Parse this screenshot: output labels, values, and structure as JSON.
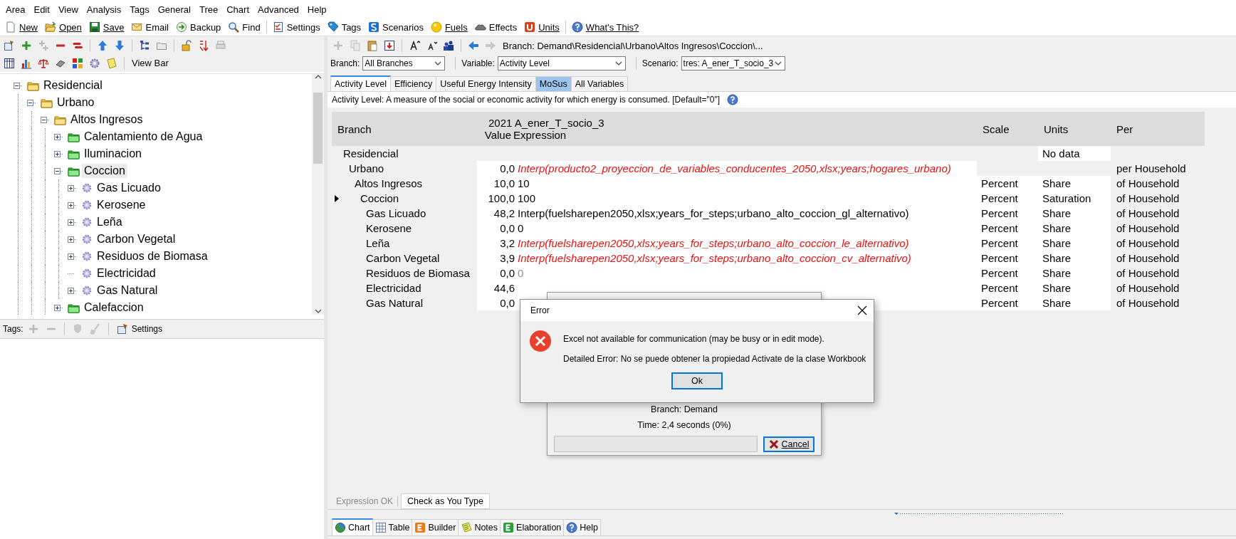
{
  "menu": [
    "Area",
    "Edit",
    "View",
    "Analysis",
    "Tags",
    "General",
    "Tree",
    "Chart",
    "Advanced",
    "Help"
  ],
  "main_toolbar": [
    {
      "label": "New",
      "kind": "new"
    },
    {
      "label": "Open",
      "kind": "open"
    },
    {
      "label": "Save",
      "kind": "save"
    },
    {
      "label": "Email",
      "kind": "email"
    },
    {
      "label": "Backup",
      "kind": "backup"
    },
    {
      "label": "Find",
      "kind": "find"
    },
    {
      "label": "Settings",
      "kind": "settings"
    },
    {
      "label": "Tags",
      "kind": "tags"
    },
    {
      "label": "Scenarios",
      "kind": "scenarios"
    },
    {
      "label": "Fuels",
      "kind": "fuels"
    },
    {
      "label": "Effects",
      "kind": "effects"
    },
    {
      "label": "Units",
      "kind": "units"
    },
    {
      "label": "What's This?",
      "kind": "help"
    }
  ],
  "view_bar_button": "View Bar",
  "tree": [
    {
      "label": "Residencial",
      "kind": "sector",
      "expandable": true,
      "expanded": true,
      "selected": false,
      "children": [
        {
          "label": "Urbano",
          "kind": "sector",
          "expandable": true,
          "expanded": true,
          "selected": false,
          "children": [
            {
              "label": "Altos Ingresos",
              "kind": "sector",
              "expandable": true,
              "expanded": true,
              "selected": false,
              "children": [
                {
                  "label": "Calentamiento de Agua",
                  "kind": "end-use",
                  "expandable": true,
                  "expanded": false,
                  "selected": false
                },
                {
                  "label": "Iluminacion",
                  "kind": "end-use",
                  "expandable": true,
                  "expanded": false,
                  "selected": false
                },
                {
                  "label": "Coccion",
                  "kind": "end-use",
                  "expandable": true,
                  "expanded": true,
                  "selected": true,
                  "children": [
                    {
                      "label": "Gas Licuado",
                      "kind": "device",
                      "expandable": true,
                      "expanded": false,
                      "selected": false
                    },
                    {
                      "label": "Kerosene",
                      "kind": "device",
                      "expandable": true,
                      "expanded": false,
                      "selected": false
                    },
                    {
                      "label": "Leña",
                      "kind": "device",
                      "expandable": true,
                      "expanded": false,
                      "selected": false
                    },
                    {
                      "label": "Carbon Vegetal",
                      "kind": "device",
                      "expandable": true,
                      "expanded": false,
                      "selected": false
                    },
                    {
                      "label": "Residuos de Biomasa",
                      "kind": "device",
                      "expandable": true,
                      "expanded": false,
                      "selected": false
                    },
                    {
                      "label": "Electricidad",
                      "kind": "device",
                      "expandable": false,
                      "expanded": false,
                      "selected": false
                    },
                    {
                      "label": "Gas Natural",
                      "kind": "device",
                      "expandable": true,
                      "expanded": false,
                      "selected": false
                    }
                  ]
                },
                {
                  "label": "Calefaccion",
                  "kind": "end-use",
                  "expandable": true,
                  "expanded": false,
                  "selected": false
                }
              ]
            }
          ]
        }
      ]
    }
  ],
  "tags_bar": {
    "label": "Tags:",
    "settings": "Settings"
  },
  "breadcrumb": "Branch: Demand\\Residencial\\Urbano\\Altos Ingresos\\Coccion\\...",
  "selectors": [
    {
      "label": "Branch:",
      "value": "All Branches"
    },
    {
      "label": "Variable:",
      "value": "Activity Level"
    },
    {
      "label": "Scenario:",
      "value": "tres: A_ener_T_socio_3"
    }
  ],
  "variable_tabs": [
    {
      "label": "Activity Level",
      "selected": true,
      "highlighted": false
    },
    {
      "label": "Efficiency",
      "selected": false,
      "highlighted": false
    },
    {
      "label": "Useful Energy Intensity",
      "selected": false,
      "highlighted": false
    },
    {
      "label": "MoSus",
      "selected": false,
      "highlighted": true
    },
    {
      "label": "All Variables",
      "selected": false,
      "highlighted": false
    }
  ],
  "description": "Activity Level: A measure of the social or economic activity for which energy is consumed. [Default=\"0\"]",
  "table": {
    "columns": {
      "branch": "Branch",
      "year_scenario": "2021 A_ener_T_socio_3",
      "value": "Value",
      "expression": "Expression",
      "scale": "Scale",
      "units": "Units",
      "per": "Per"
    },
    "rows": [
      {
        "branch": "Residencial",
        "units": "No data",
        "selected": false,
        "children": [
          {
            "branch": "Urbano",
            "value": "0,0",
            "expression": {
              "text": "Interp(producto2_proyeccion_de_variables_conducentes_2050,xlsx;years;hogares_urbano)",
              "kind": "error"
            },
            "per": "per Household",
            "selected": false,
            "children": [
              {
                "branch": "Altos Ingresos",
                "value": "10,0",
                "expression": {
                  "text": "10",
                  "kind": "normal"
                },
                "scale": "Percent",
                "units": "Share",
                "per": "of Household",
                "selected": false,
                "children": [
                  {
                    "branch": "Coccion",
                    "value": "100,0",
                    "expression": {
                      "text": "100",
                      "kind": "normal"
                    },
                    "scale": "Percent",
                    "units": "Saturation",
                    "per": "of Household",
                    "selected": true,
                    "children": [
                      {
                        "branch": "Gas Licuado",
                        "value": "48,2",
                        "expression": {
                          "text": "Interp(fuelsharepen2050,xlsx;years_for_steps;urbano_alto_coccion_gl_alternativo)",
                          "kind": "normal"
                        },
                        "scale": "Percent",
                        "units": "Share",
                        "per": "of Household",
                        "selected": false
                      },
                      {
                        "branch": "Kerosene",
                        "value": "0,0",
                        "expression": {
                          "text": "0",
                          "kind": "normal"
                        },
                        "scale": "Percent",
                        "units": "Share",
                        "per": "of Household",
                        "selected": false
                      },
                      {
                        "branch": "Leña",
                        "value": "3,2",
                        "expression": {
                          "text": "Interp(fuelsharepen2050,xlsx;years_for_steps;urbano_alto_coccion_le_alternativo)",
                          "kind": "error"
                        },
                        "scale": "Percent",
                        "units": "Share",
                        "per": "of Household",
                        "selected": false
                      },
                      {
                        "branch": "Carbon Vegetal",
                        "value": "3,9",
                        "expression": {
                          "text": "Interp(fuelsharepen2050,xlsx;years_for_steps;urbano_alto_coccion_cv_alternativo)",
                          "kind": "error"
                        },
                        "scale": "Percent",
                        "units": "Share",
                        "per": "of Household",
                        "selected": false
                      },
                      {
                        "branch": "Residuos de Biomasa",
                        "value": "0,0",
                        "expression": {
                          "text": "0",
                          "kind": "inherited"
                        },
                        "scale": "Percent",
                        "units": "Share",
                        "per": "of Household",
                        "selected": false
                      },
                      {
                        "branch": "Electricidad",
                        "value": "44,6",
                        "scale": "Percent",
                        "units": "Share",
                        "per": "of Household",
                        "selected": false
                      },
                      {
                        "branch": "Gas Natural",
                        "value": "0,0",
                        "scale": "Percent",
                        "units": "Share",
                        "per": "of Household",
                        "selected": false
                      }
                    ]
                  }
                ]
              }
            ]
          }
        ]
      }
    ]
  },
  "status": {
    "message": "Expression OK",
    "message_disabled": true,
    "check_button": "Check as You Type"
  },
  "bottom_tabs": [
    {
      "label": "Chart",
      "kind": "chart",
      "selected": true
    },
    {
      "label": "Table",
      "kind": "table",
      "selected": false
    },
    {
      "label": "Builder",
      "kind": "builder",
      "selected": false
    },
    {
      "label": "Notes",
      "kind": "notes",
      "selected": false
    },
    {
      "label": "Elaboration",
      "kind": "elaboration",
      "selected": false
    },
    {
      "label": "Help",
      "kind": "help",
      "selected": false
    }
  ],
  "progress_dialog": {
    "branch": "Branch: Demand",
    "time": "Time: 2,4 seconds (0%)",
    "level": 0,
    "cancel": "Cancel"
  },
  "error_dialog": {
    "title": "Error",
    "message": "Excel not available for communication (may be busy or in edit mode).",
    "detail": "Detailed Error: No se puede obtener la propiedad Activate de la clase Workbook",
    "ok": "Ok"
  }
}
